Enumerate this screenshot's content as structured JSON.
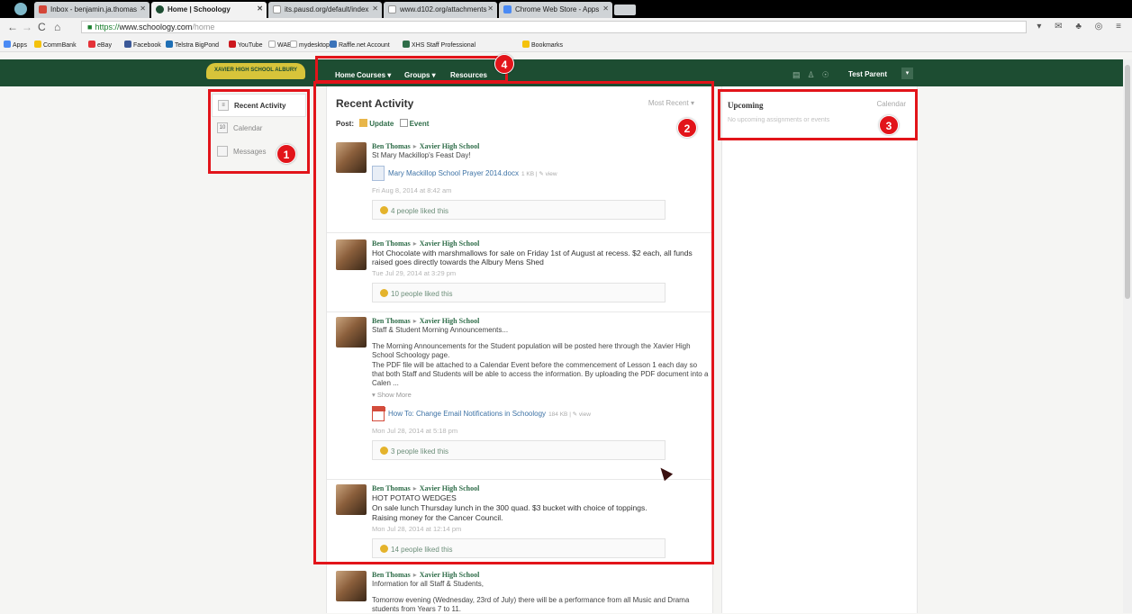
{
  "browser": {
    "tabs": [
      {
        "label": "Inbox - benjamin.ja.thomas",
        "icon_color": "#d44638",
        "active": false
      },
      {
        "label": "Home | Schoology",
        "icon_color": "#1d4d32",
        "active": true
      },
      {
        "label": "its.pausd.org/default/index",
        "icon_color": "#ffffff",
        "active": false
      },
      {
        "label": "www.d102.org/attachments",
        "icon_color": "#ffffff",
        "active": false
      },
      {
        "label": "Chrome Web Store - Apps",
        "icon_color": "#4a8af4",
        "active": false
      }
    ],
    "url_https": "https://",
    "url_host": "www.schoology.com",
    "url_path": "/home",
    "bookmarks": [
      {
        "label": "Apps",
        "color": "#4a8af4"
      },
      {
        "label": "CommBank",
        "color": "#f4c20d"
      },
      {
        "label": "eBay",
        "color": "#e53238"
      },
      {
        "label": "Facebook",
        "color": "#3b5998"
      },
      {
        "label": "Telstra BigPond",
        "color": "#1f6fb5"
      },
      {
        "label": "YouTube",
        "color": "#cc181e"
      },
      {
        "label": "WAB",
        "color": "#dddddd"
      },
      {
        "label": "mydesktop",
        "color": "#dddddd"
      },
      {
        "label": "Raffle.net Account",
        "color": "#3b73b9"
      },
      {
        "label": "XHS Staff Professional",
        "color": "#2f6d49"
      },
      {
        "label": "Bookmarks",
        "color": "#f4c20d"
      }
    ]
  },
  "header": {
    "logo_text": "XAVIER HIGH SCHOOL ALBURY",
    "nav": {
      "home": "Home",
      "courses": "Courses ▾",
      "groups": "Groups ▾",
      "resources": "Resources"
    },
    "user_name": "Test Parent",
    "user_menu_glyph": "▾"
  },
  "sidebar": {
    "items": [
      {
        "label": "Recent Activity",
        "glyph": "≡"
      },
      {
        "label": "Calendar",
        "glyph": "10"
      },
      {
        "label": "Messages",
        "glyph": ""
      }
    ]
  },
  "main": {
    "title": "Recent Activity",
    "sort_label": "Most Recent ▾",
    "post_label": "Post:",
    "post_update": "Update",
    "post_event": "Event",
    "posts": [
      {
        "author": "Ben Thomas",
        "group": "Xavier High School",
        "text": "St Mary Mackillop's Feast Day!",
        "attachment": "Mary Mackillop School Prayer 2014.docx",
        "attachment_meta": "1 KB | ✎ view",
        "date": "Fri Aug 8, 2014 at 8:42 am",
        "likes": "4 people liked this"
      },
      {
        "author": "Ben Thomas",
        "group": "Xavier High School",
        "text": "Hot Chocolate with marshmallows for sale on Friday 1st of August at recess. $2 each, all funds raised goes directly towards the Albury Mens Shed",
        "date": "Tue Jul 29, 2014 at 3:29 pm",
        "likes": "10 people liked this"
      },
      {
        "author": "Ben Thomas",
        "group": "Xavier High School",
        "text": "Staff & Student Morning Announcements...",
        "text2": "The Morning Announcements for the Student population will be posted here through the Xavier High School Schoology page.",
        "text3": "The PDF file will be attached to a Calendar Event before the commencement of Lesson 1 each day so that both Staff and Students will be able to access the information. By uploading the PDF document into a Calen ...",
        "show_more": "▾ Show More",
        "attachment": "How To: Change Email Notifications in Schoology",
        "attachment_meta": "184 KB | ✎ view",
        "date": "Mon Jul 28, 2014 at 5:18 pm",
        "likes": "3 people liked this"
      },
      {
        "author": "Ben Thomas",
        "group": "Xavier High School",
        "text": "HOT POTATO WEDGES",
        "text2": "On sale lunch Thursday lunch in the 300 quad. $3 bucket with choice of toppings.",
        "text3": "Raising money for the Cancer Council.",
        "date": "Mon Jul 28, 2014 at 12:14 pm",
        "likes": "14 people liked this"
      },
      {
        "author": "Ben Thomas",
        "group": "Xavier High School",
        "text": "Information for all Staff & Students,",
        "text2": "Tomorrow evening (Wednesday, 23rd of July) there will be a performance from all Music and Drama students from Years 7 to 11."
      }
    ]
  },
  "upcoming": {
    "title": "Upcoming",
    "calendar_link": "Calendar",
    "empty_text": "No upcoming assignments or events"
  },
  "annotations": [
    "1",
    "2",
    "3",
    "4"
  ],
  "colors": {
    "brand": "#1d4d32",
    "link": "#2f6d49",
    "annotation": "#e2141a",
    "logo": "#d7c43a"
  }
}
